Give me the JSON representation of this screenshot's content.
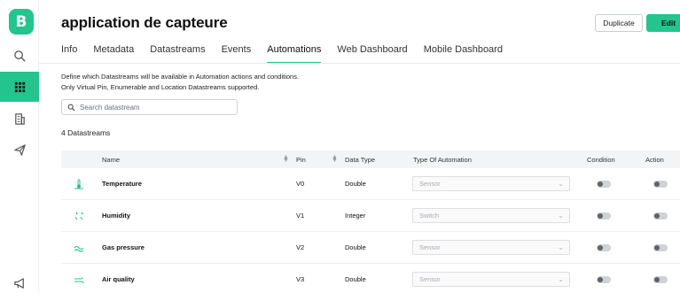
{
  "sidebar": {
    "logo": "B",
    "items": [
      {
        "icon": "search-icon",
        "active": false
      },
      {
        "icon": "grid-icon",
        "active": true
      },
      {
        "icon": "building-icon",
        "active": false
      },
      {
        "icon": "send-icon",
        "active": false
      },
      {
        "icon": "megaphone-icon",
        "active": false
      }
    ]
  },
  "header": {
    "title": "application de capteure",
    "duplicate_label": "Duplicate",
    "edit_label": "Edit"
  },
  "tabs": [
    {
      "label": "Info",
      "active": false
    },
    {
      "label": "Metadata",
      "active": false
    },
    {
      "label": "Datastreams",
      "active": false
    },
    {
      "label": "Events",
      "active": false
    },
    {
      "label": "Automations",
      "active": true
    },
    {
      "label": "Web Dashboard",
      "active": false
    },
    {
      "label": "Mobile Dashboard",
      "active": false
    }
  ],
  "description": {
    "line1": "Define which Datastreams will be available in Automation actions and conditions.",
    "line2": "Only Virtual Pin, Enumerable and Location Datastreams supported."
  },
  "search": {
    "placeholder": "Search datastream"
  },
  "count_label": "4 Datastreams",
  "table": {
    "columns": {
      "name": "Name",
      "pin": "Pin",
      "data_type": "Data Type",
      "type_of_automation": "Type Of Automation",
      "condition": "Condition",
      "action": "Action"
    },
    "rows": [
      {
        "icon": "thermometer-icon",
        "name": "Temperature",
        "pin": "V0",
        "data_type": "Double",
        "automation": "Sensor",
        "condition": false,
        "action": false
      },
      {
        "icon": "humidity-icon",
        "name": "Humidity",
        "pin": "V1",
        "data_type": "Integer",
        "automation": "Switch",
        "condition": false,
        "action": false
      },
      {
        "icon": "gas-icon",
        "name": "Gas pressure",
        "pin": "V2",
        "data_type": "Double",
        "automation": "Sensor",
        "condition": false,
        "action": false
      },
      {
        "icon": "air-quality-icon",
        "name": "Air quality",
        "pin": "V3",
        "data_type": "Double",
        "automation": "Sensor",
        "condition": false,
        "action": false
      }
    ]
  },
  "colors": {
    "accent": "#23c48e"
  }
}
